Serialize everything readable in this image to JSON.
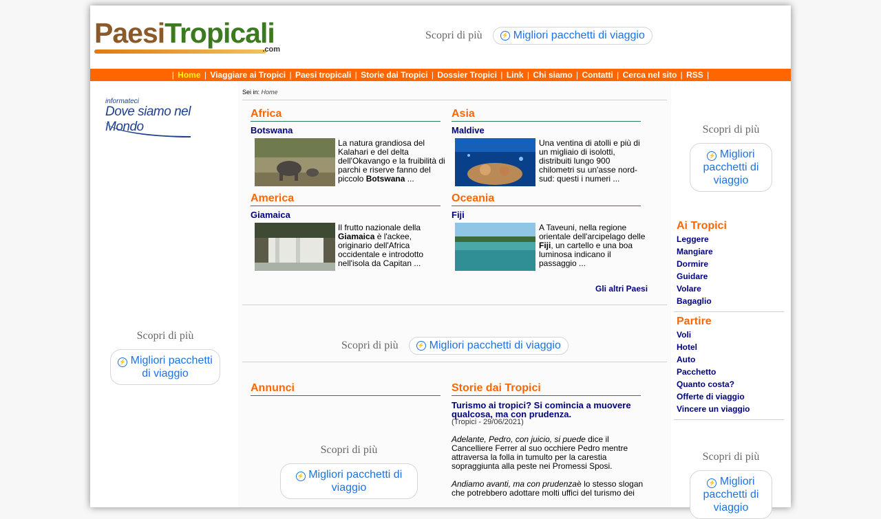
{
  "header": {
    "logo_paesi": "Paesi",
    "logo_tropicali": "Tropicali",
    "logo_com": ".com",
    "ad_text": "Scopri di più",
    "ad_button": "Migliori pacchetti di viaggio"
  },
  "nav": {
    "items": [
      "Home",
      "Viaggiare ai Tropici",
      "Paesi tropicali",
      "Storie dai Tropici",
      "Dossier Tropici",
      "Link",
      "Chi siamo",
      "Contatti",
      "Cerca nel sito",
      "RSS"
    ],
    "separator": "|"
  },
  "left": {
    "informateci": "informateci",
    "where": "Dove siamo nel Mondo",
    "ad_text": "Scopri di più",
    "ad_button": "Migliori pacchetti di viaggio"
  },
  "main": {
    "breadcrumb_label": "Sei in:",
    "breadcrumb_current": "Home",
    "regions": [
      {
        "title": "Africa",
        "country": "Botswana",
        "text_a": "La natura grandiosa del Kalahari e del delta dell'Okavango e la fruibilità di parchi e riserve fanno del piccolo ",
        "bold": "Botswana",
        "text_b": " ..."
      },
      {
        "title": "Asia",
        "country": "Maldive",
        "text_a": "Una ventina di atolli e più di un migliaio di isolotti, distribuiti lungo 900 chilometri su un'asse nord-sud: questi i numeri ...",
        "bold": "",
        "text_b": ""
      },
      {
        "title": "America",
        "country": "Giamaica",
        "text_a": "Il frutto nazionale della ",
        "bold": "Giamaica",
        "text_b": " è l'ackee, originario dell'Africa occidentale e introdotto nell'isola da Capitan ..."
      },
      {
        "title": "Oceania",
        "country": "Fiji",
        "text_a": "A Taveuni, nella regione orientale dell'arcipelago delle ",
        "bold": "Fiji",
        "text_b": ", un cartello e una boa luminosa indicano il passaggio ..."
      }
    ],
    "more_countries": "Gli altri Paesi",
    "mid_ad_text": "Scopri di più",
    "mid_ad_button": "Migliori pacchetti di viaggio",
    "annunci_title": "Annunci",
    "annunci_ad_text": "Scopri di più",
    "annunci_ad_button": "Migliori pacchetti di viaggio",
    "stories_title": "Storie dai Tropici",
    "story_headline": "Turismo ai tropici? Si comincia a muovere qualcosa, ma con prudenza.",
    "story_meta": "(Tropici - 29/06/2021)",
    "story_p1_italic": "Adelante, Pedro, con juicio, si puede",
    "story_p1_rest": " dice il Cancelliere Ferrer al suo occhiere Pedro mentre attraversa la folla in tumulto per la carestia sopraggiunta alla peste nei Promessi Sposi.",
    "story_p2_italic": "Andiamo avanti, ma con prudenza",
    "story_p2_rest": "è lo stesso slogan che potrebbero adottare molti uffici del turismo dei"
  },
  "right": {
    "ad_text": "Scopri di più",
    "ad_button": "Migliori pacchetti di viaggio",
    "ai_tropici_title": "Ai Tropici",
    "ai_tropici_links": [
      "Leggere",
      "Mangiare",
      "Dormire",
      "Guidare",
      "Volare",
      "Bagaglio"
    ],
    "partire_title": "Partire",
    "partire_links": [
      "Voli",
      "Hotel",
      "Auto",
      "Pacchetto",
      "Quanto costa?",
      "Offerte di viaggio",
      "Vincere un viaggio"
    ],
    "ad2_text": "Scopri di più",
    "ad2_button": "Migliori pacchetti di viaggio"
  },
  "colors": {
    "nav_bg": "#ff6600",
    "nav_active": "#ffff00",
    "section_title": "#ff6600",
    "link": "#00007f",
    "ad_link": "#1a73e8"
  }
}
